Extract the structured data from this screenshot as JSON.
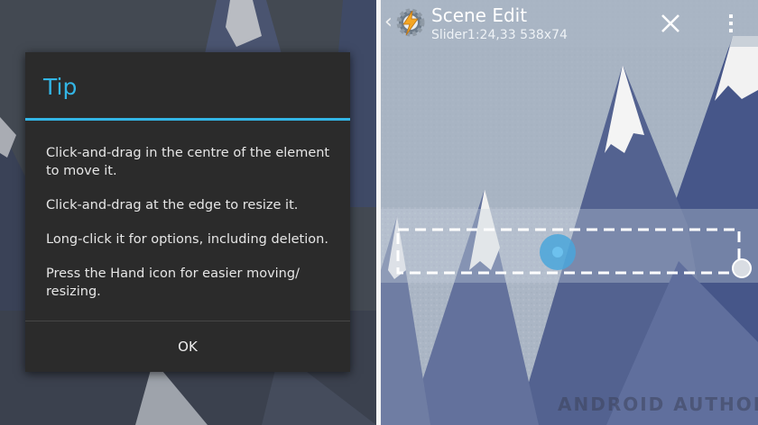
{
  "dialog": {
    "title": "Tip",
    "lines": [
      "Click-and-drag in the centre of the element to move it.",
      "Click-and-drag at the edge to resize it.",
      "Long-click it for options, including deletion.",
      "Press the Hand icon for easier moving/ resizing."
    ],
    "ok_label": "OK"
  },
  "scene_edit": {
    "title": "Scene Edit",
    "subtitle": "Slider1:24,33 538x74",
    "app_icon": "tasker-gear-lightning-icon",
    "close_icon": "close-icon",
    "overflow_icon": "overflow-menu-icon",
    "selected_element": "slider"
  },
  "watermark": "ANDROID AUTHORITY",
  "colors": {
    "accent": "#33b5e5",
    "dialog_bg": "#2b2b2b",
    "mountain_dark": "#3e4f7e",
    "sky": "#a7b2c2"
  }
}
